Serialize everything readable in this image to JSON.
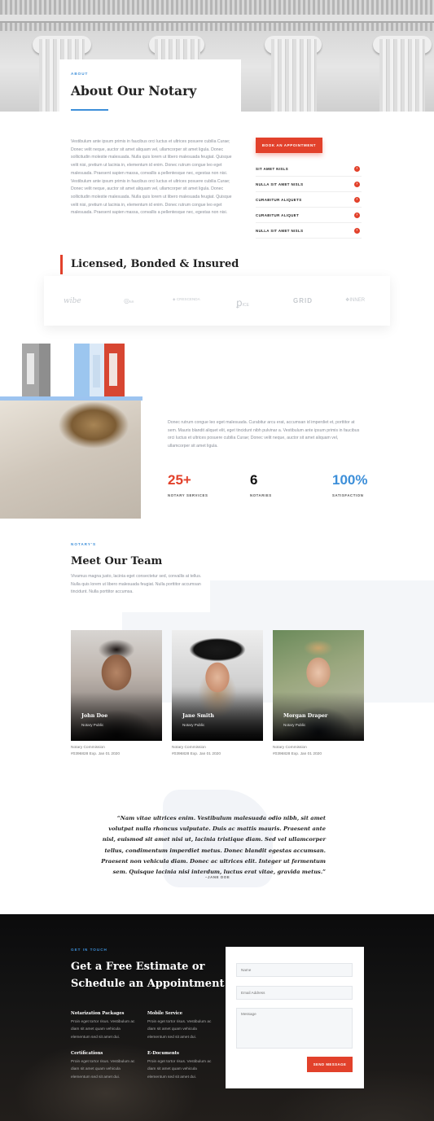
{
  "about": {
    "eyebrow": "ABOUT",
    "title": "About Our Notary",
    "body": "Vestibulum ante ipsum primis in faucibus orci luctus et ultrices posuere cubilia Curae; Donec velit neque, auctor sit amet aliquam vel, ullamcorper sit amet ligula. Donec sollicitudin molestie malesuada. Nulla quis lorem ut libero malesuada feugiat. Quisque velit nisi, pretium ut lacinia in, elementum id enim. Donec rutrum congue leo eget malesuada. Praesent sapien massa, convallis a pellentesque nec, egestas non nisi. Vestibulum ante ipsum primis in faucibus orci luctus et ultrices posuere cubilia Curae; Donec velit neque, auctor sit amet aliquam vel, ullamcorper sit amet ligula. Donec sollicitudin molestie malesuada. Nulla quis lorem ut libero malesuada feugiat. Quisque velit nisi, pretium ut lacinia in, elementum id enim. Donec rutrum congue leo eget malesuada. Praesent sapien massa, convallis a pellentesque nec, egestas non nisi.",
    "book_label": "BOOK AN APPOINTMENT",
    "services": [
      "SIT AMET NISLS",
      "NULLA SIT AMET NISLS",
      "CURABITUR ALIQUETS",
      "CURABITUR ALIQUET",
      "NULLA SIT AMET NISLS"
    ],
    "arrow": "›"
  },
  "licensed": {
    "title": "Licensed, Bonded & Insured",
    "logos": [
      "wibe",
      "BR",
      "CRESCENDA",
      "ICE",
      "GRID",
      "INNER"
    ]
  },
  "stats": {
    "body": "Donec rutrum congue leo eget malesuada. Curabitur arcu erat, accumsan id imperdiet et, porttitor at sem. Mauris blandit aliquet elit, eget tincidunt nibh pulvinar a. Vestibulum ante ipsum primis in faucibus orci luctus et ultrices posuere cubilia Curae; Donec velit neque, auctor sit amet aliquam vel, ullamcorper sit amet ligula.",
    "items": [
      {
        "value": "25+",
        "label": "NOTARY SERVICES",
        "color": "#e2412b"
      },
      {
        "value": "6",
        "label": "NOTARIES",
        "color": "#111111"
      },
      {
        "value": "100%",
        "label": "SATISFACTION",
        "color": "#3d8fd9"
      }
    ]
  },
  "team": {
    "eyebrow": "NOTARY'S",
    "title": "Meet Our Team",
    "body": "Vivamus magna justo, lacinia eget consectetur sed, convallis at tellus. Nulla quis lorem ut libero malesuada feugiat. Nulla porttitor accumsan tincidunt. Nulla porttitor accumsa.",
    "members": [
      {
        "name": "John Doe",
        "role": "Notary Public",
        "comm1": "Notary Commission",
        "comm2": "#0396828 Exp. Jan 01 2020"
      },
      {
        "name": "Jane Smith",
        "role": "Notary Public",
        "comm1": "Notary Commission",
        "comm2": "#0396828 Exp. Jan 01 2020"
      },
      {
        "name": "Morgan Draper",
        "role": "Notary Public",
        "comm1": "Notary Commission",
        "comm2": "#0396828 Exp. Jan 01 2020"
      }
    ]
  },
  "quote": {
    "text": "“Nam vitae ultrices enim. Vestibulum malesuada odio nibh, sit amet volutpat nulla rhoncus vulputate. Duis ac mattis mauris. Praesent ante nisl, euismod sit amet nisi ut, lacinia tristique diam. Sed vel ullamcorper tellus, condimentum imperdiet metus. Donec blandit egestas accumsan. Praesent non vehicula diam. Donec ac ultrices elit. Integer ut fermentum sem. Quisque lacinia nisi interdum, luctus erat vitae, gravida metus.”",
    "author": "–JANE DOE"
  },
  "contact": {
    "eyebrow": "GET IN TOUCH",
    "title": "Get a Free Estimate or Schedule an Appointment",
    "blocks": [
      {
        "title": "Notarization Packages",
        "text": "Proin eget tortor risus. Vestibulum ac diam sit amet quam vehicula elementum sed sit amet dui."
      },
      {
        "title": "Mobile Service",
        "text": "Proin eget tortor risus. Vestibulum ac diam sit amet quam vehicula elementum sed sit amet dui."
      },
      {
        "title": "Certifications",
        "text": "Proin eget tortor risus. Vestibulum ac diam sit amet quam vehicula elementum sed sit amet dui."
      },
      {
        "title": "E-Documents",
        "text": "Proin eget tortor risus. Vestibulum ac diam sit amet quam vehicula elementum sed sit amet dui."
      }
    ],
    "form": {
      "name_placeholder": "Name",
      "email_placeholder": "Email Address",
      "message_placeholder": "Message",
      "send_label": "SEND MESSAGE"
    }
  },
  "colors": {
    "accent": "#e2412b",
    "blue": "#3d8fd9",
    "dark": "#111111"
  }
}
